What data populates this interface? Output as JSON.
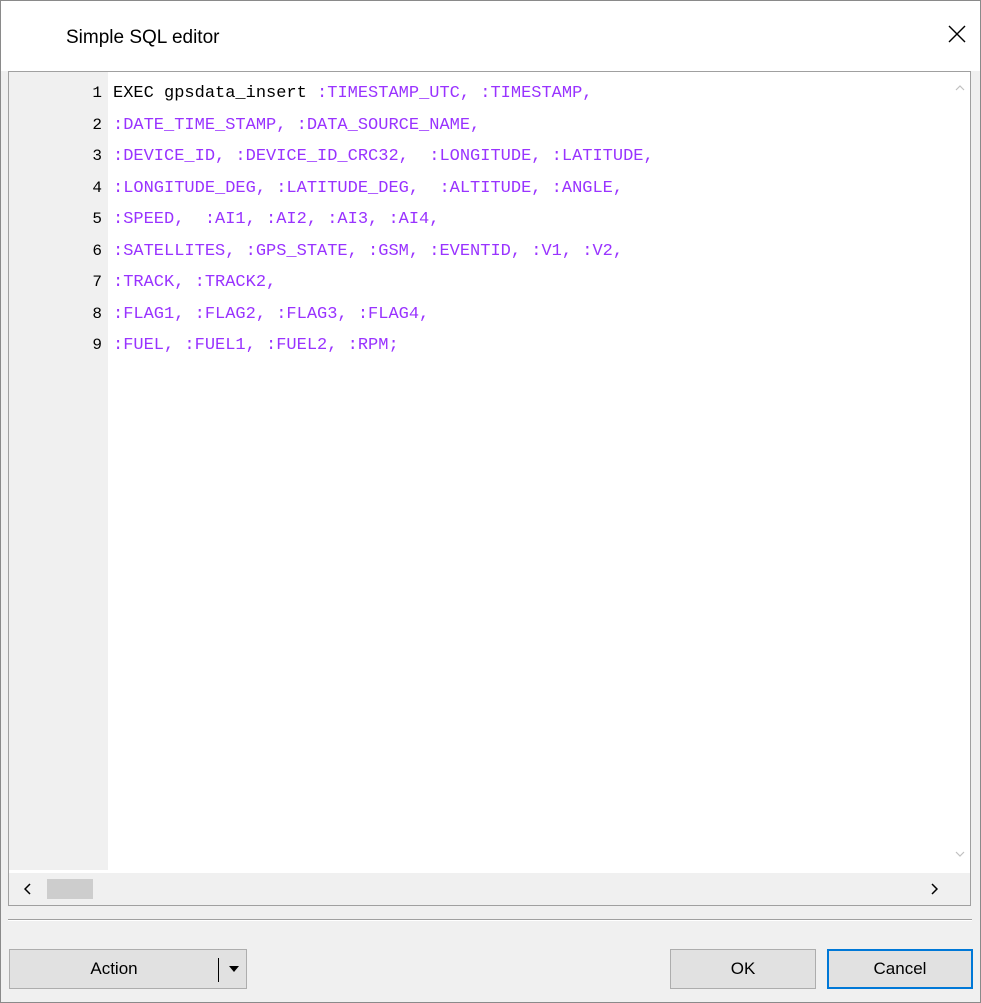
{
  "window": {
    "title": "Simple SQL editor",
    "close_icon": "close-icon"
  },
  "editor": {
    "lines": [
      {
        "num": "1",
        "tokens": [
          {
            "t": "EXEC gpsdata_insert ",
            "k": "kw"
          },
          {
            "t": ":TIMESTAMP_UTC, :TIMESTAMP,",
            "k": "param"
          }
        ]
      },
      {
        "num": "2",
        "tokens": [
          {
            "t": ":DATE_TIME_STAMP, :DATA_SOURCE_NAME,",
            "k": "param"
          }
        ]
      },
      {
        "num": "3",
        "tokens": [
          {
            "t": ":DEVICE_ID, :DEVICE_ID_CRC32,  :LONGITUDE, :LATITUDE,",
            "k": "param"
          }
        ]
      },
      {
        "num": "4",
        "tokens": [
          {
            "t": ":LONGITUDE_DEG, :LATITUDE_DEG,  :ALTITUDE, :ANGLE,",
            "k": "param"
          }
        ]
      },
      {
        "num": "5",
        "tokens": [
          {
            "t": ":SPEED,  :AI1, :AI2, :AI3, :AI4,",
            "k": "param"
          }
        ]
      },
      {
        "num": "6",
        "tokens": [
          {
            "t": ":SATELLITES, :GPS_STATE, :GSM, :EVENTID, :V1, :V2,",
            "k": "param"
          }
        ]
      },
      {
        "num": "7",
        "tokens": [
          {
            "t": ":TRACK, :TRACK2,",
            "k": "param"
          }
        ]
      },
      {
        "num": "8",
        "tokens": [
          {
            "t": ":FLAG1, :FLAG2, :FLAG3, :FLAG4,",
            "k": "param"
          }
        ]
      },
      {
        "num": "9",
        "tokens": [
          {
            "t": ":FUEL, :FUEL1, :FUEL2, :RPM;",
            "k": "param"
          }
        ]
      }
    ],
    "colors": {
      "keyword": "#000000",
      "param": "#9933ff"
    }
  },
  "buttons": {
    "action_label": "Action",
    "ok_label": "OK",
    "cancel_label": "Cancel"
  }
}
